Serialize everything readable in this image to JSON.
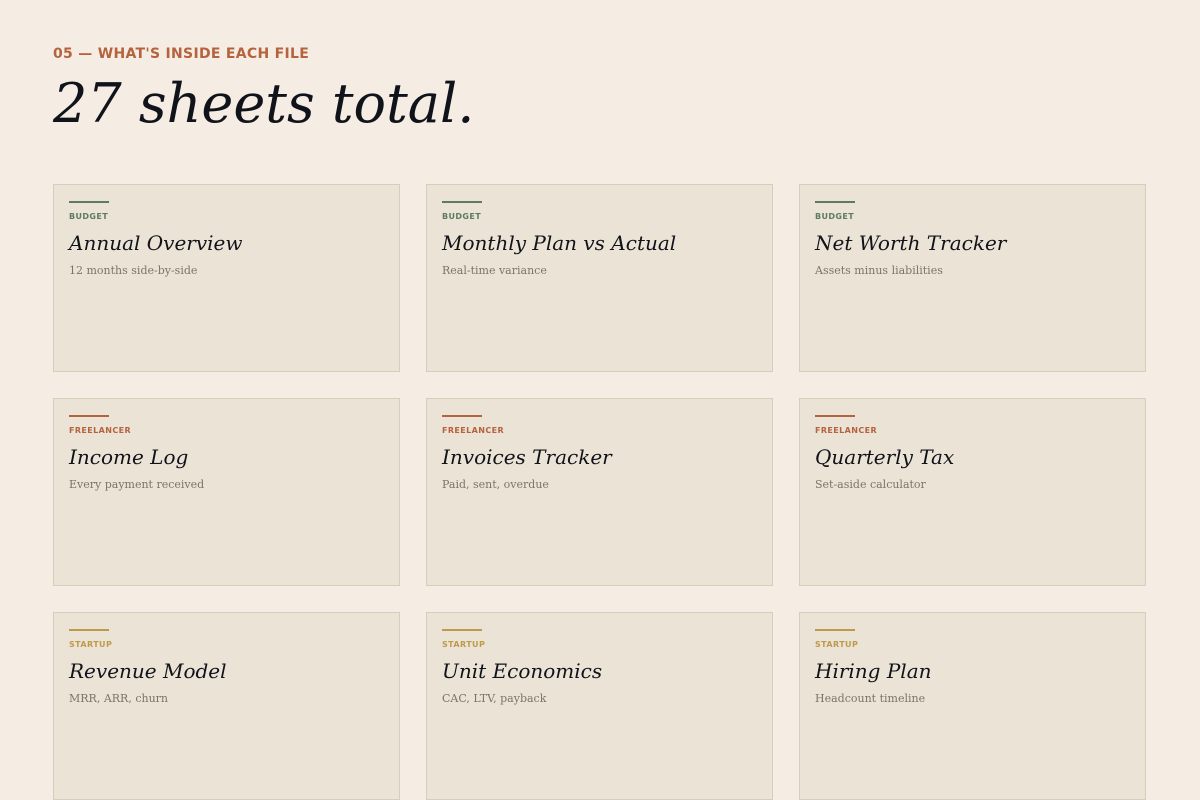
{
  "header": {
    "eyebrow": "05 — WHAT'S INSIDE EACH FILE",
    "headline": "27 sheets total."
  },
  "colors": {
    "background": "#f5ede3",
    "card": "#ebe3d6",
    "budget": "#5d7b62",
    "freelancer": "#b5623e",
    "startup": "#bf9a4a"
  },
  "cards": [
    {
      "tag": "BUDGET",
      "title": "Annual Overview",
      "desc": "12 months side-by-side"
    },
    {
      "tag": "BUDGET",
      "title": "Monthly Plan vs Actual",
      "desc": "Real-time variance"
    },
    {
      "tag": "BUDGET",
      "title": "Net Worth Tracker",
      "desc": "Assets minus liabilities"
    },
    {
      "tag": "FREELANCER",
      "title": "Income Log",
      "desc": "Every payment received"
    },
    {
      "tag": "FREELANCER",
      "title": "Invoices Tracker",
      "desc": "Paid, sent, overdue"
    },
    {
      "tag": "FREELANCER",
      "title": "Quarterly Tax",
      "desc": "Set-aside calculator"
    },
    {
      "tag": "STARTUP",
      "title": "Revenue Model",
      "desc": "MRR, ARR, churn"
    },
    {
      "tag": "STARTUP",
      "title": "Unit Economics",
      "desc": "CAC, LTV, payback"
    },
    {
      "tag": "STARTUP",
      "title": "Hiring Plan",
      "desc": "Headcount timeline"
    }
  ]
}
